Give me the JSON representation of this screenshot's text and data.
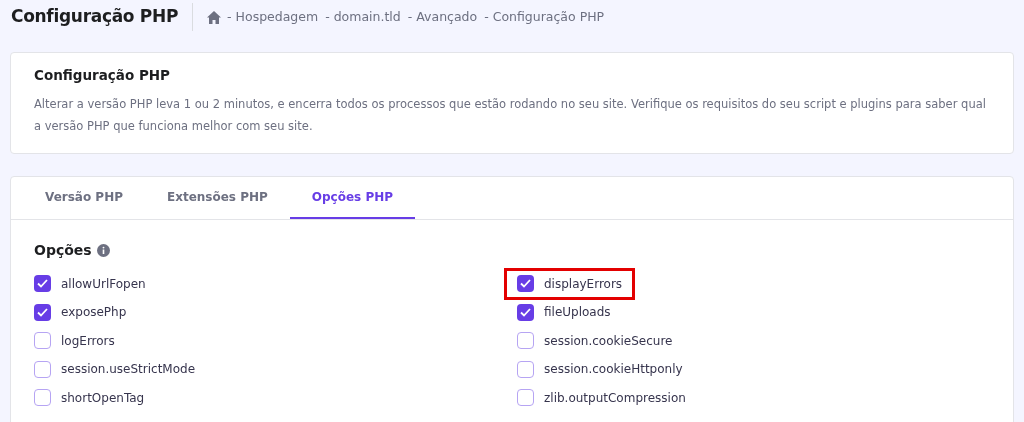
{
  "header": {
    "title": "Configuração PHP",
    "breadcrumb": [
      "- Hospedagem",
      "- domain.tld",
      "- Avançado",
      "- Configuração PHP"
    ]
  },
  "info_card": {
    "title": "Configuração PHP",
    "text": "Alterar a versão PHP leva 1 ou 2 minutos, e encerra todos os processos que estão rodando no seu site. Verifique os requisitos do seu script e plugins para saber qual a versão PHP que funciona melhor com seu site."
  },
  "tabs": [
    {
      "label": "Versão PHP",
      "selected": false
    },
    {
      "label": "Extensões PHP",
      "selected": false
    },
    {
      "label": "Opções PHP",
      "selected": true
    }
  ],
  "options_title": "Opções",
  "columns": [
    [
      {
        "label": "allowUrlFopen",
        "checked": true,
        "highlighted": false
      },
      {
        "label": "exposePhp",
        "checked": true,
        "highlighted": false
      },
      {
        "label": "logErrors",
        "checked": false,
        "highlighted": false
      },
      {
        "label": "session.useStrictMode",
        "checked": false,
        "highlighted": false
      },
      {
        "label": "shortOpenTag",
        "checked": false,
        "highlighted": false
      }
    ],
    [
      {
        "label": "displayErrors",
        "checked": true,
        "highlighted": true
      },
      {
        "label": "fileUploads",
        "checked": true,
        "highlighted": false
      },
      {
        "label": "session.cookieSecure",
        "checked": false,
        "highlighted": false
      },
      {
        "label": "session.cookieHttponly",
        "checked": false,
        "highlighted": false
      },
      {
        "label": "zlib.outputCompression",
        "checked": false,
        "highlighted": false
      }
    ]
  ]
}
